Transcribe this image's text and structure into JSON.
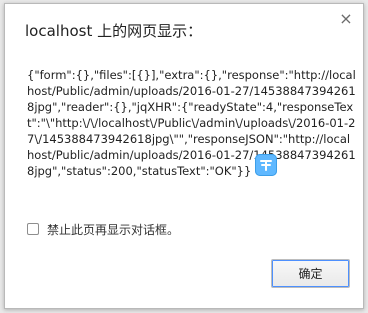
{
  "dialog": {
    "title": "localhost 上的网页显示：",
    "close_icon": "close-icon",
    "message": "{\"form\":{},\"files\":[{}],\"extra\":{},\"response\":\"http://localhost/Public/admin/uploads/2016-01-27/145388473942618jpg\",\"reader\":{},\"jqXHR\":{\"readyState\":4,\"responseText\":\"\\\"http:\\/\\/localhost\\/Public\\/admin\\/uploads\\/2016-01-27\\/145388473942618jpg\\\"\",\"responseJSON\":\"http://localhost/Public/admin/uploads/2016-01-27/145388473942618jpg\",\"status\":200,\"statusText\":\"OK\"}}",
    "checkbox_label": "禁止此页再显示对话框。",
    "ok_button": "确定"
  },
  "colors": {
    "backdrop": "#e9e9e9",
    "dialog_bg": "#ffffff",
    "focus_ring": "#4d90fe",
    "overlay_icon": "#5fb8ff"
  }
}
